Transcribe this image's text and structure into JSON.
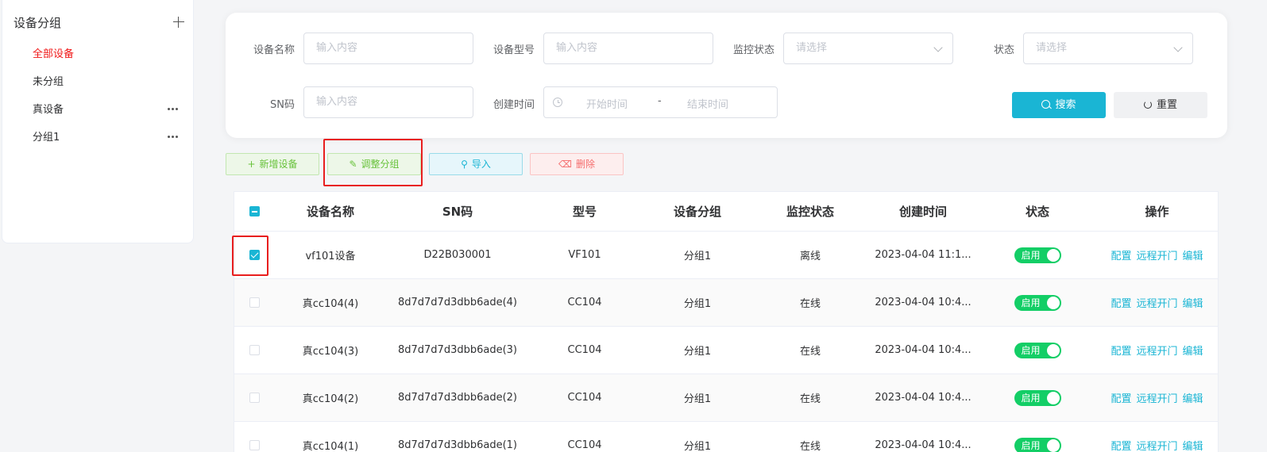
{
  "sidebar": {
    "title": "设备分组",
    "groups": [
      {
        "label": "全部设备",
        "active": true
      },
      {
        "label": "未分组"
      },
      {
        "label": "真设备"
      },
      {
        "label": "分组1"
      }
    ]
  },
  "filters": {
    "device_name_label": "设备名称",
    "device_name_placeholder": "输入内容",
    "device_model_label": "设备型号",
    "device_model_placeholder": "输入内容",
    "monitor_status_label": "监控状态",
    "monitor_status_placeholder": "请选择",
    "status_label": "状态",
    "status_placeholder": "请选择",
    "sn_label": "SN码",
    "sn_placeholder": "输入内容",
    "created_time_label": "创建时间",
    "start_time_placeholder": "开始时间",
    "range_separator": "-",
    "end_time_placeholder": "结束时间",
    "search_label": "搜索",
    "reset_label": "重置"
  },
  "toolbar": {
    "add_label": "新增设备",
    "adjust_label": "调整分组",
    "import_label": "导入",
    "delete_label": "删除"
  },
  "table": {
    "headers": [
      "设备名称",
      "SN码",
      "型号",
      "设备分组",
      "监控状态",
      "创建时间",
      "状态",
      "操作"
    ],
    "rows": [
      {
        "name": "vf101设备",
        "sn": "D22B030001",
        "model": "VF101",
        "group": "分组1",
        "monitor": "离线",
        "created": "2023-04-04 11:1...",
        "status": "启用",
        "checked": true
      },
      {
        "name": "真cc104(4)",
        "sn": "8d7d7d7d3dbb6ade(4)",
        "model": "CC104",
        "group": "分组1",
        "monitor": "在线",
        "created": "2023-04-04 10:4...",
        "status": "启用",
        "checked": false
      },
      {
        "name": "真cc104(3)",
        "sn": "8d7d7d7d3dbb6ade(3)",
        "model": "CC104",
        "group": "分组1",
        "monitor": "在线",
        "created": "2023-04-04 10:4...",
        "status": "启用",
        "checked": false
      },
      {
        "name": "真cc104(2)",
        "sn": "8d7d7d7d3dbb6ade(2)",
        "model": "CC104",
        "group": "分组1",
        "monitor": "在线",
        "created": "2023-04-04 10:4...",
        "status": "启用",
        "checked": false
      },
      {
        "name": "真cc104(1)",
        "sn": "8d7d7d7d3dbb6ade(1)",
        "model": "CC104",
        "group": "分组1",
        "monitor": "在线",
        "created": "2023-04-04 10:4...",
        "status": "启用",
        "checked": false
      }
    ],
    "actions": [
      "配置",
      "远程开门",
      "编辑"
    ]
  },
  "colors": {
    "accent": "#1ab5d4",
    "active_group": "#f01818",
    "offline": "#e03c4a",
    "online": "#67c23a",
    "switch_on": "#13ce66",
    "highlight_box": "#e81e1e"
  }
}
